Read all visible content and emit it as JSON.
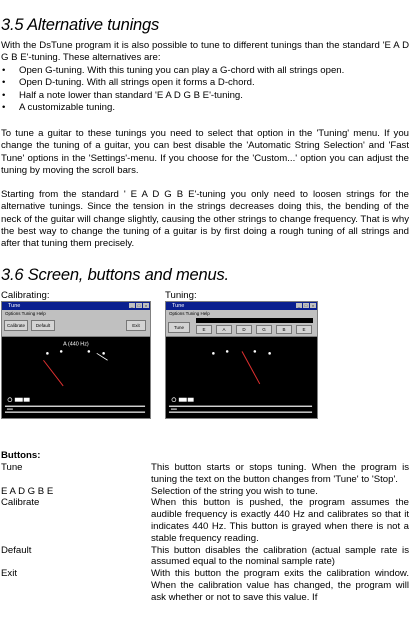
{
  "section_35": {
    "title": "3.5 Alternative tunings",
    "intro": "With the DsTune program it is also possible to tune to different tunings than the standard 'E A D G B E'-tuning. These alternatives are:",
    "bullets": [
      "Open G-tuning. With this tuning you can play a G-chord with all strings open.",
      "Open D-tuning. With all strings open it forms a D-chord.",
      "Half a note lower than standard 'E A D G B E'-tuning.",
      "A customizable tuning."
    ],
    "para_tune": "To tune a guitar to these tunings you need to select that option in the 'Tuning' menu. If you change the tuning of a guitar, you can best disable the 'Automatic String Selection' and 'Fast Tune' options in the 'Settings'-menu. If you choose for the 'Custom...' option you can adjust the tuning by moving the scroll bars.",
    "para_start": "Starting from the standard ' E A D G B E'-tuning you only need to loosen strings for the alternative tunings. Since the tension in the strings decreases doing this, the bending of the neck of the guitar will change slightly, causing the other strings to change frequency. That is why the best way to change the tuning of a guitar is by first doing a rough tuning of all strings and after that tuning them precisely."
  },
  "section_36": {
    "title": "3.6 Screen, buttons and menus.",
    "caption_calibrating": "Calibrating:",
    "caption_tuning": "Tuning:",
    "screenshot_cal": {
      "window_title": "Tune",
      "menu": "Options  Tuning  Help",
      "buttons": [
        "Calibrate",
        "Default",
        "",
        "Exit"
      ],
      "readout": "A (440 Hz)"
    },
    "screenshot_tun": {
      "window_title": "Tune",
      "menu": "Options  Tuning  Help",
      "buttons": [
        "Tune",
        "E",
        "A",
        "D",
        "G",
        "B",
        "E"
      ]
    },
    "buttons_heading": "Buttons:",
    "definitions": [
      {
        "term": "Tune",
        "desc": "This button starts or stops tuning. When the program is tuning the text on the button changes from 'Tune' to 'Stop'."
      },
      {
        "term": "E A D G B E",
        "desc": "Selection of the string you wish to tune."
      },
      {
        "term": "Calibrate",
        "desc": "When this button is pushed, the program assumes the audible frequency is exactly 440 Hz and calibrates so that it indicates 440 Hz. This button is grayed when there is not a stable frequency reading."
      },
      {
        "term": "Default",
        "desc": "This button disables the calibration (actual sample rate is assumed equal to the nominal sample rate)"
      },
      {
        "term": "Exit",
        "desc": "With this button the program exits the calibration window. When the calibration value has changed, the program will ask whether or not to save this value. If"
      }
    ]
  }
}
